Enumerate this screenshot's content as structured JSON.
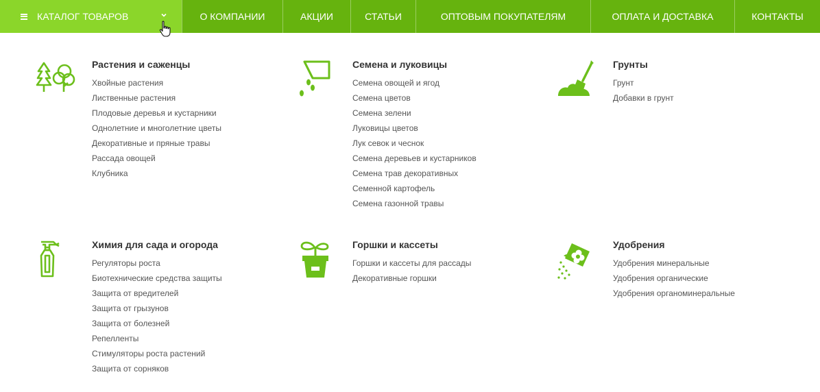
{
  "nav": {
    "catalog_label": "КАТАЛОГ ТОВАРОВ",
    "items": [
      "О КОМПАНИИ",
      "АКЦИИ",
      "СТАТЬИ",
      "ОПТОВЫМ ПОКУПАТЕЛЯМ",
      "ОПЛАТА И ДОСТАВКА",
      "КОНТАКТЫ"
    ]
  },
  "colors": {
    "nav_bg": "#66b30e",
    "catalog_bg": "#8bd62a",
    "icon": "#6cbf1b"
  },
  "categories": [
    {
      "title": "Растения и саженцы",
      "icon": "trees-icon",
      "links": [
        "Хвойные растения",
        "Лиственные растения",
        "Плодовые деревья и кустарники",
        "Однолетние и многолетние цветы",
        "Декоративные и пряные травы",
        "Рассада овощей",
        "Клубника"
      ]
    },
    {
      "title": "Семена и луковицы",
      "icon": "seed-packet-icon",
      "links": [
        "Семена овощей и ягод",
        "Семена цветов",
        "Семена зелени",
        "Луковицы цветов",
        "Лук севок и чеснок",
        "Семена деревьев и кустарников",
        "Семена трав декоративных",
        "Семенной картофель",
        "Семена газонной травы"
      ]
    },
    {
      "title": "Грунты",
      "icon": "shovel-soil-icon",
      "links": [
        "Грунт",
        "Добавки в грунт"
      ]
    },
    {
      "title": "Химия для сада и огорода",
      "icon": "spray-bottle-icon",
      "links": [
        "Регуляторы роста",
        "Биотехнические средства защиты",
        "Защита от вредителей",
        "Защита от грызунов",
        "Защита от болезней",
        "Репелленты",
        "Стимуляторы роста растений",
        "Защита от сорняков"
      ]
    },
    {
      "title": "Горшки и кассеты",
      "icon": "plant-pot-icon",
      "links": [
        "Горшки и кассеты для рассады",
        "Декоративные горшки"
      ]
    },
    {
      "title": "Удобрения",
      "icon": "fertilizer-bag-icon",
      "links": [
        "Удобрения минеральные",
        "Удобрения органические",
        "Удобрения органоминеральные"
      ]
    }
  ]
}
